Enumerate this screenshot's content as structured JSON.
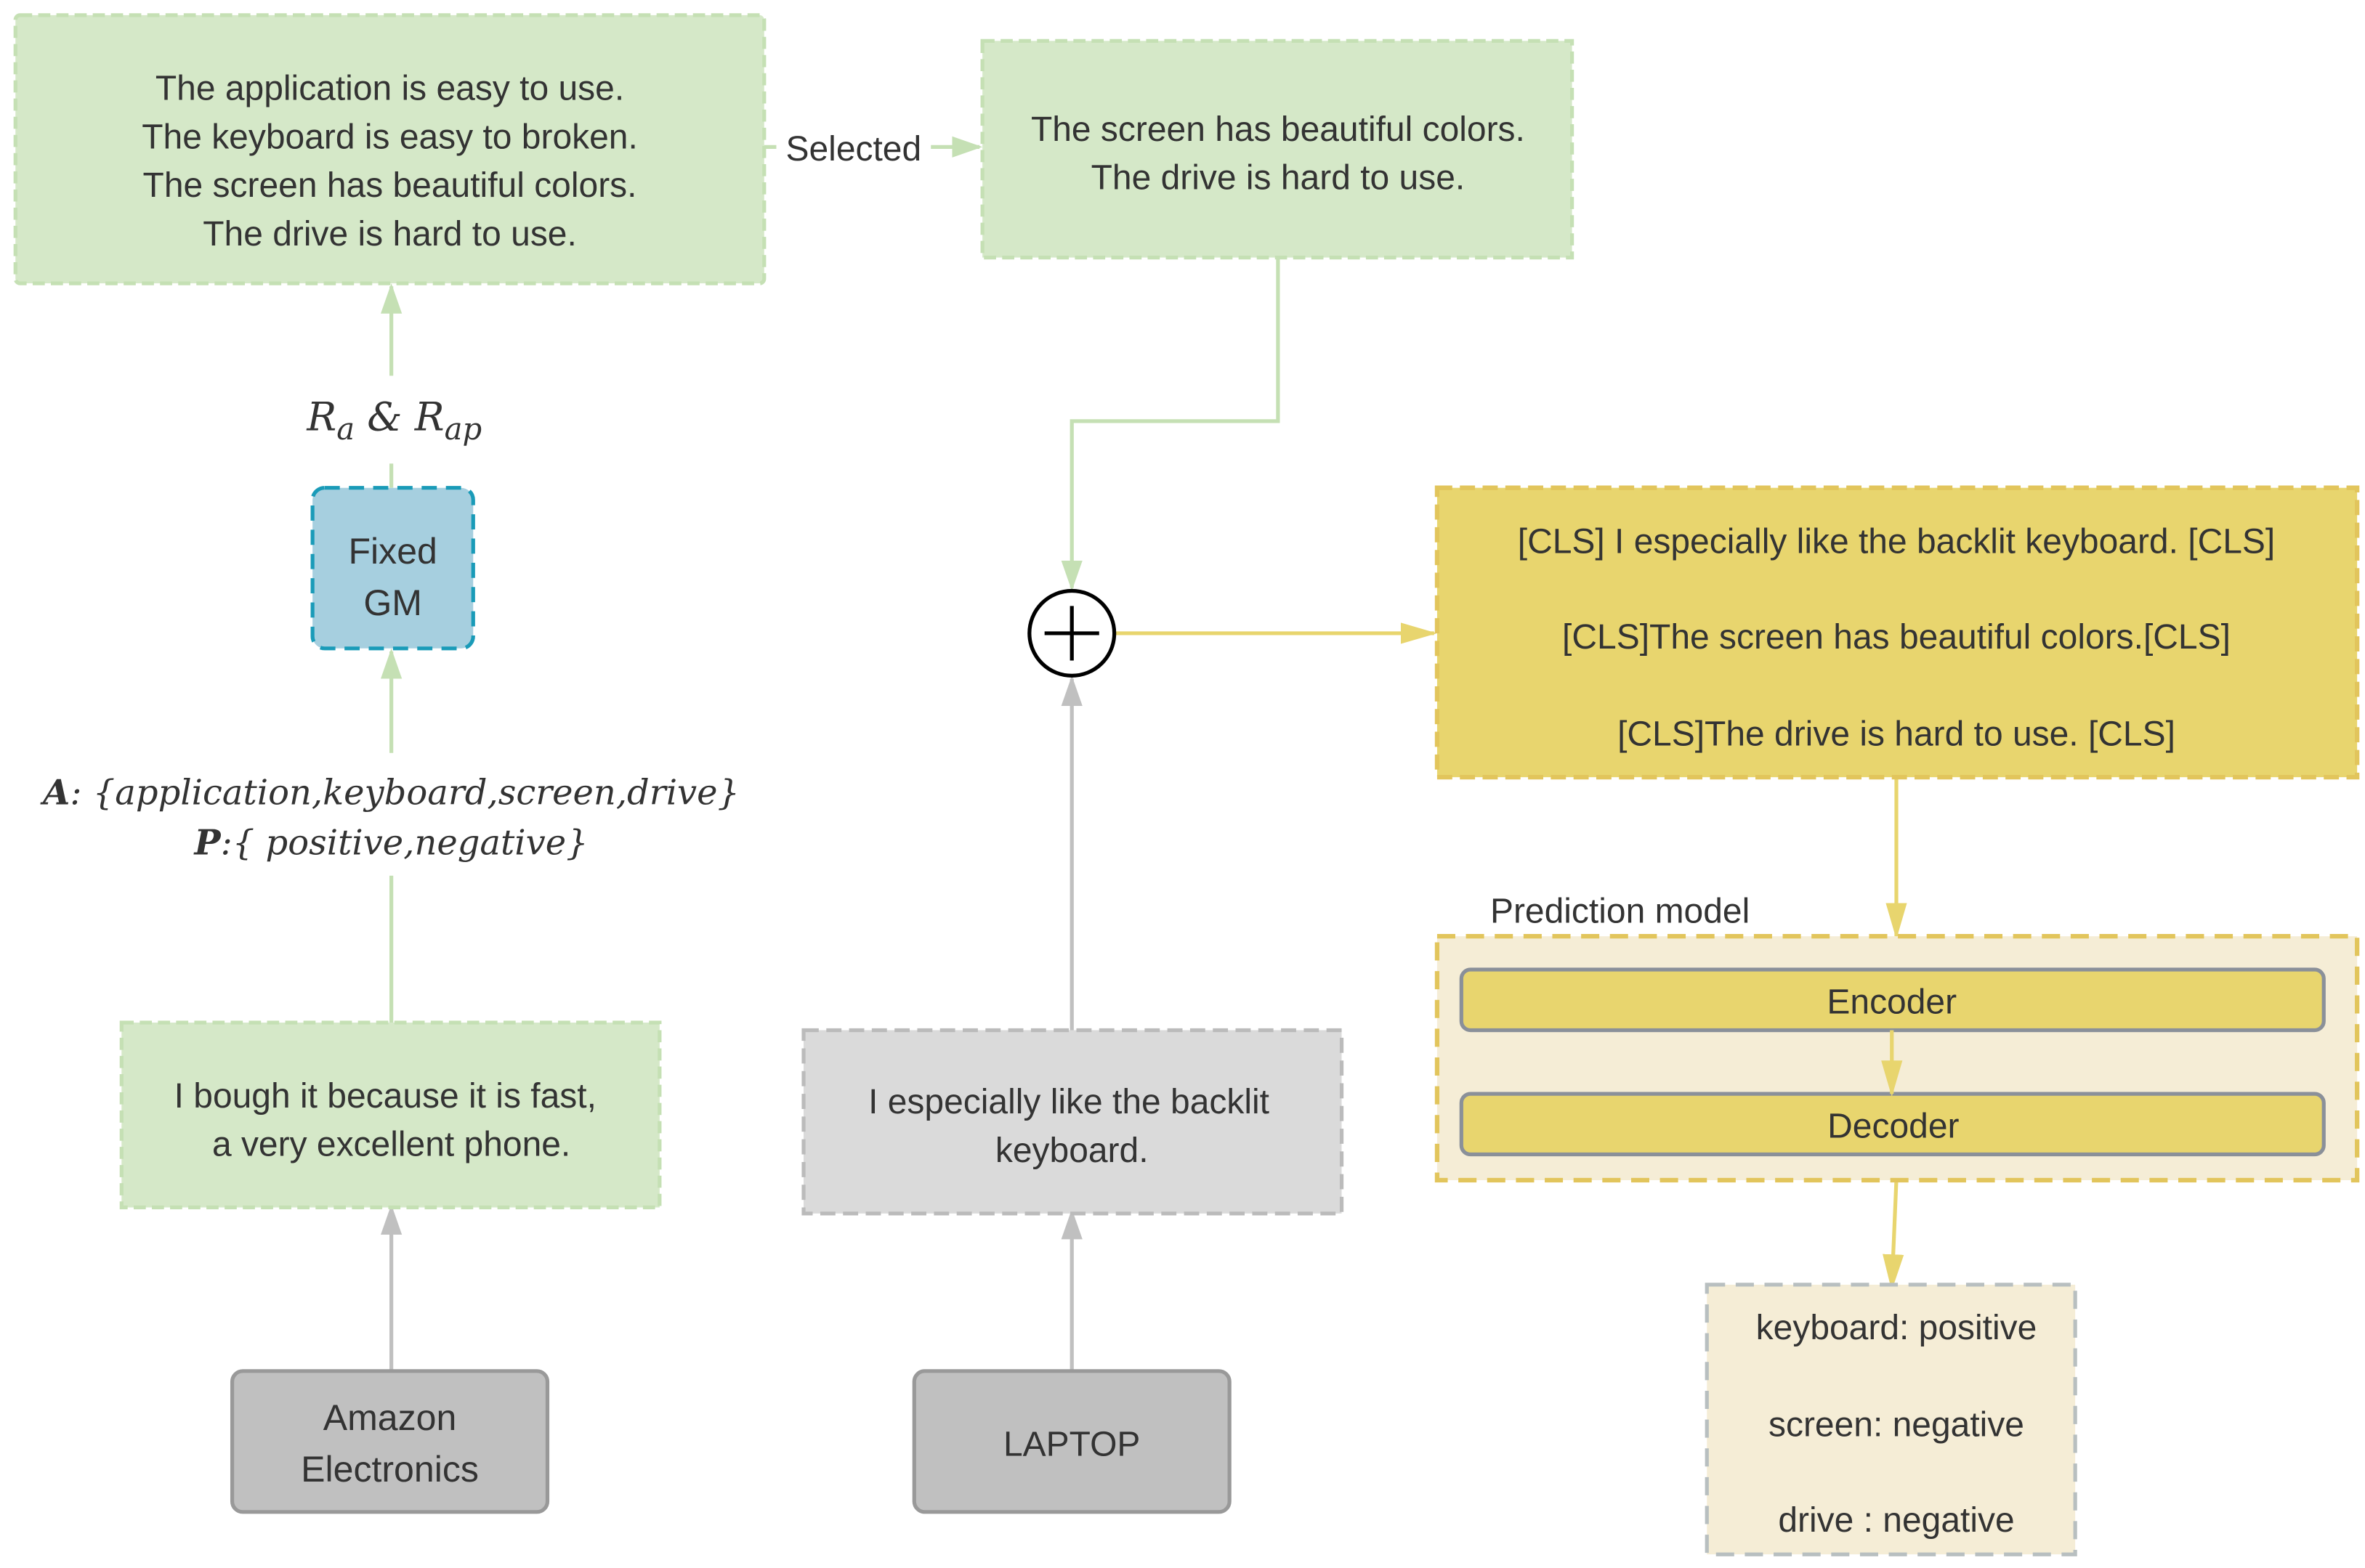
{
  "retrieved_box": {
    "lines": [
      "The application is easy to use.",
      "The keyboard is easy to broken.",
      "The screen has beautiful colors.",
      "The drive is hard to use."
    ]
  },
  "selected_label": "Selected",
  "selected_box": {
    "lines": [
      "The screen has beautiful colors.",
      "The drive is hard to use."
    ]
  },
  "retrieval_label": {
    "r": "R",
    "sub_a": "a",
    "amp": " & ",
    "sub_ap": "ap"
  },
  "fixed_gm": {
    "lines": [
      "Fixed",
      "GM"
    ]
  },
  "aspect_polarity": {
    "a_key": "A",
    "a_value": ": {application,keyboard,screen,drive}",
    "p_key": "P",
    "p_value": ":{ positive,negative}"
  },
  "source_sentence_box": {
    "lines": [
      "I bough it because it is fast,",
      "a very excellent phone."
    ]
  },
  "source_domain": {
    "lines": [
      "Amazon",
      "Electronics"
    ]
  },
  "target_sentence_box": {
    "lines": [
      "I especially like the backlit",
      "keyboard."
    ]
  },
  "target_domain": {
    "label": "LAPTOP"
  },
  "concat_box": {
    "lines": [
      "[CLS] I especially like the backlit keyboard. [CLS]",
      "[CLS]The screen has beautiful colors.[CLS]",
      "[CLS]The drive is hard to use. [CLS]"
    ]
  },
  "prediction_model": {
    "title": "Prediction model",
    "encoder": "Encoder",
    "decoder": "Decoder"
  },
  "output_box": {
    "lines": [
      "keyboard: positive",
      "screen: negative",
      "drive : negative"
    ]
  },
  "colors": {
    "green_fill": "#d5e8c8",
    "green_line": "#c5e0b4",
    "blue_fill": "#a6cfdf",
    "blue_line": "#1a9bb8",
    "yellow_fill": "#e8d56e",
    "yellow_line": "#e2c55c",
    "cream_fill": "#f5edd6",
    "gray_fill": "#c0c0c0"
  }
}
